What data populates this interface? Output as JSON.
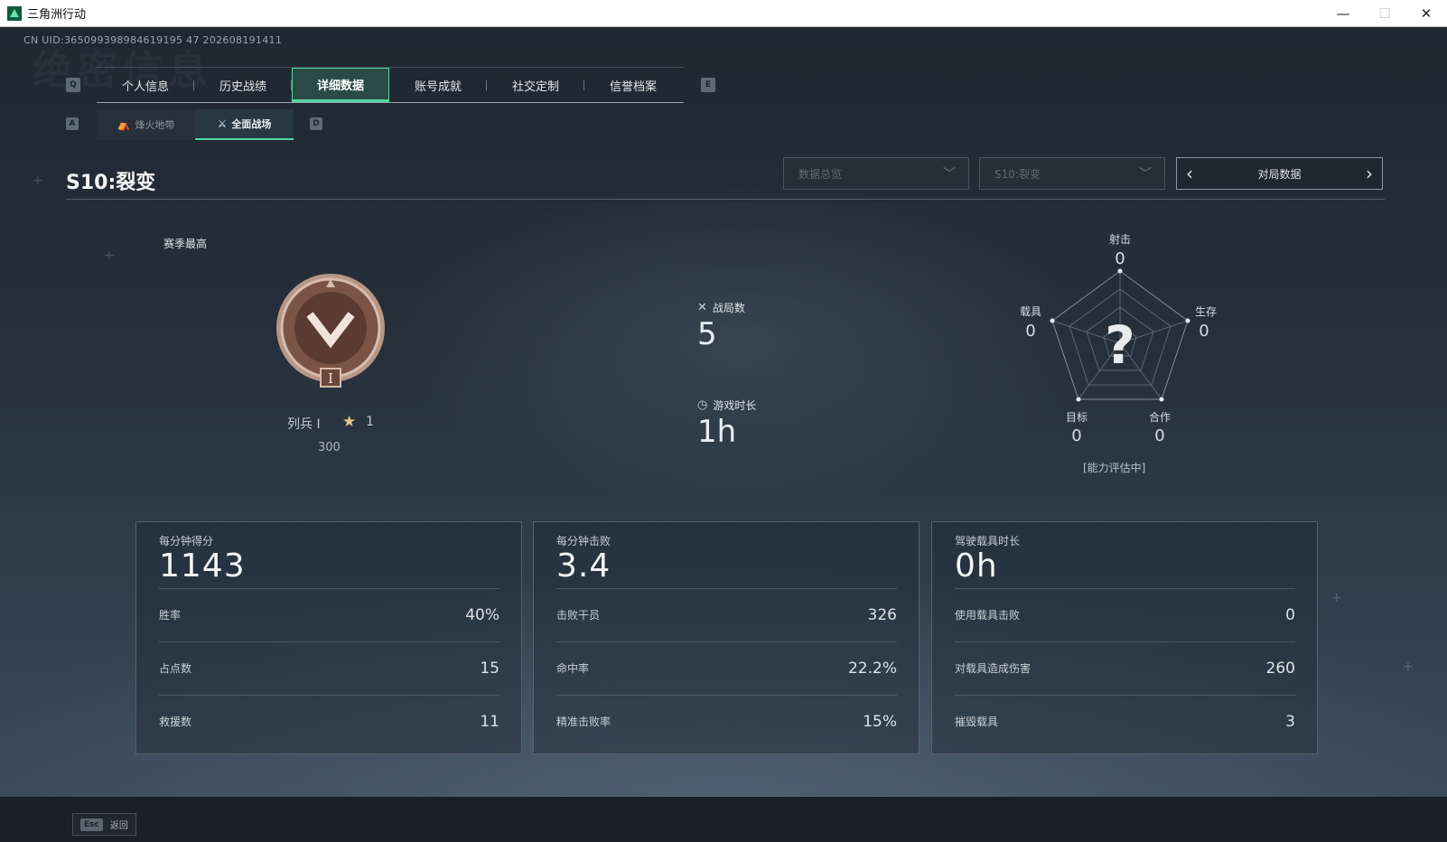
{
  "window": {
    "title": "三角洲行动",
    "minimize": "—",
    "maximize": "☐",
    "close": "✕"
  },
  "uid": "CN UID:365099398984619195 47 202608191411",
  "ghost_title": "绝密信息",
  "nav": {
    "prev_key": "Q",
    "next_key": "E",
    "tabs": [
      {
        "label": "个人信息"
      },
      {
        "label": "历史战绩"
      },
      {
        "label": "详细数据",
        "active": true
      },
      {
        "label": "账号成就"
      },
      {
        "label": "社交定制"
      },
      {
        "label": "信誉档案"
      }
    ]
  },
  "sub_nav": {
    "prev_key": "A",
    "next_key": "D",
    "tabs": [
      {
        "label": "烽火地带",
        "icon": "fire-zone-icon"
      },
      {
        "label": "全面战场",
        "icon": "battlefield-icon",
        "active": true
      }
    ]
  },
  "season": {
    "title": "S10:裂变",
    "dropdown_overview": "数据总览",
    "dropdown_season": "S10:裂变",
    "pager_label": "对局数据"
  },
  "rank": {
    "best_label": "赛季最高",
    "name": "列兵 I",
    "stars": "1",
    "points": "300"
  },
  "summary": {
    "matches_label": "战局数",
    "matches_value": "5",
    "playtime_label": "游戏时长",
    "playtime_value": "1h"
  },
  "radar": {
    "center_symbol": "?",
    "note": "[能力评估中]",
    "axes": [
      {
        "label": "射击",
        "value": "0"
      },
      {
        "label": "生存",
        "value": "0"
      },
      {
        "label": "合作",
        "value": "0"
      },
      {
        "label": "目标",
        "value": "0"
      },
      {
        "label": "载具",
        "value": "0"
      }
    ]
  },
  "cards": [
    {
      "title": "每分钟得分",
      "value": "1143",
      "rows": [
        {
          "label": "胜率",
          "value": "40%"
        },
        {
          "label": "占点数",
          "value": "15"
        },
        {
          "label": "救援数",
          "value": "11"
        }
      ]
    },
    {
      "title": "每分钟击败",
      "value": "3.4",
      "rows": [
        {
          "label": "击败干员",
          "value": "326"
        },
        {
          "label": "命中率",
          "value": "22.2%"
        },
        {
          "label": "精准击败率",
          "value": "15%"
        }
      ]
    },
    {
      "title": "驾驶载具时长",
      "value": "0h",
      "rows": [
        {
          "label": "使用载具击败",
          "value": "0"
        },
        {
          "label": "对载具造成伤害",
          "value": "260"
        },
        {
          "label": "摧毁载具",
          "value": "3"
        }
      ]
    }
  ],
  "footer": {
    "esc_key": "Esc",
    "back_label": "返回"
  },
  "colors": {
    "accent": "#4fd6a0",
    "medal": "#8a5a48",
    "background": "#26303b"
  }
}
